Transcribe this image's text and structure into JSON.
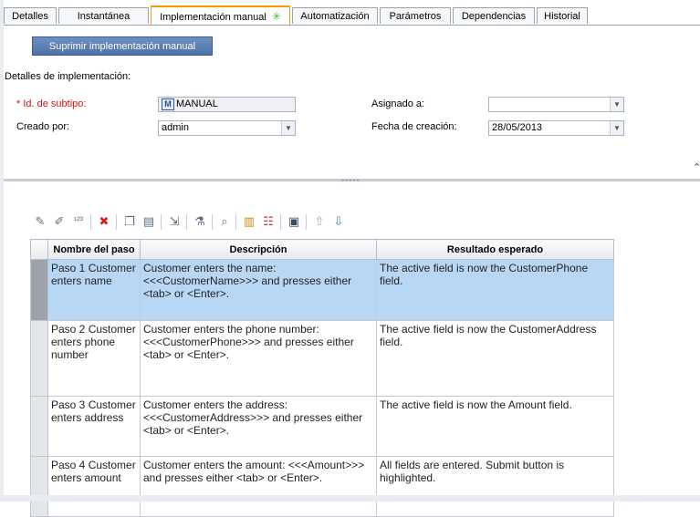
{
  "tabs": [
    {
      "label": "Detalles"
    },
    {
      "label": "Instantánea"
    },
    {
      "label": "Implementación manual",
      "active": true,
      "modified": true
    },
    {
      "label": "Automatización"
    },
    {
      "label": "Parámetros"
    },
    {
      "label": "Dependencias"
    },
    {
      "label": "Historial"
    }
  ],
  "actions": {
    "suppress_label": "Suprimir implementación manual"
  },
  "section": {
    "title": "Detalles de implementación:"
  },
  "form": {
    "subtype_label": "* Id. de subtipo:",
    "subtype_value": "MANUAL",
    "subtype_icon": "manual-icon",
    "created_by_label": "Creado por:",
    "created_by_value": "admin",
    "assigned_label": "Asignado a:",
    "assigned_value": "",
    "date_label": "Fecha de creación:",
    "date_value": "28/05/2013"
  },
  "toolbar_icons": [
    "new-step-icon",
    "edit-step-icon",
    "renumber-steps-icon",
    "delete-icon",
    "copy-icon",
    "paste-icon",
    "call-test-icon",
    "insert-parameter-icon",
    "find-icon",
    "select-columns-icon",
    "grid-filter-icon",
    "save-icon",
    "move-up-icon",
    "move-down-icon"
  ],
  "table": {
    "headers": {
      "name": "Nombre del paso",
      "description": "Descripción",
      "expected": "Resultado esperado"
    },
    "rows": [
      {
        "name": "Paso 1 Customer enters name",
        "description": "Customer enters the name: <<<CustomerName>>> and presses either <tab> or <Enter>.",
        "expected": "The active field is now the CustomerPhone field."
      },
      {
        "name": "Paso 2 Customer enters phone number",
        "description": "Customer enters the phone number: <<<CustomerPhone>>> and presses either <tab> or <Enter>.",
        "expected": "The active field is now the CustomerAddress field."
      },
      {
        "name": "Paso 3 Customer enters address",
        "description": "Customer enters the address: <<<CustomerAddress>>> and presses either <tab> or <Enter>.",
        "expected": " The active field is now the Amount field."
      },
      {
        "name": "Paso 4 Customer enters amount",
        "description": "Customer enters the amount: <<<Amount>>> and presses either <tab> or <Enter>.",
        "expected": "All fields are entered. Submit button is highlighted."
      }
    ]
  }
}
